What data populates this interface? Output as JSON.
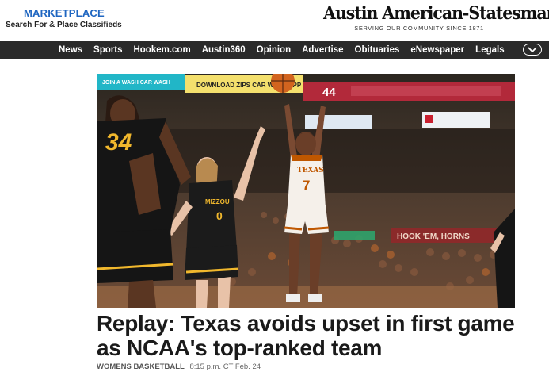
{
  "marketplace": {
    "title": "MARKETPLACE",
    "subtitle": "Search For & Place Classifieds"
  },
  "masthead": {
    "title": "Austin American-Statesman",
    "tagline": "SERVING OUR COMMUNITY SINCE 1871"
  },
  "nav": {
    "items": [
      "News",
      "Sports",
      "Hookem.com",
      "Austin360",
      "Opinion",
      "Advertise",
      "Obituaries",
      "eNewspaper",
      "Legals"
    ],
    "more_icon": "chevron-down-icon"
  },
  "hero": {
    "banner_text": "DOWNLOAD ZIPS CAR WASH APP",
    "banner_left": "JOIN A WASH CAR WASH",
    "score_left": "44",
    "arena_sign": "HOOK 'EM, HORNS",
    "player_texas": {
      "team": "TEXAS",
      "number": "7"
    },
    "player_mizzou_a": {
      "number": "34"
    },
    "player_mizzou_b": {
      "team": "MIZZOU",
      "number": "0"
    },
    "colors": {
      "burnt_orange": "#bf5700",
      "mizzou_gold": "#f1b82d",
      "black": "#111111"
    }
  },
  "article": {
    "headline": "Replay: Texas avoids upset in first game as NCAA's top-ranked team",
    "category": "WOMENS BASKETBALL",
    "timestamp": "8:15 p.m. CT Feb. 24"
  }
}
